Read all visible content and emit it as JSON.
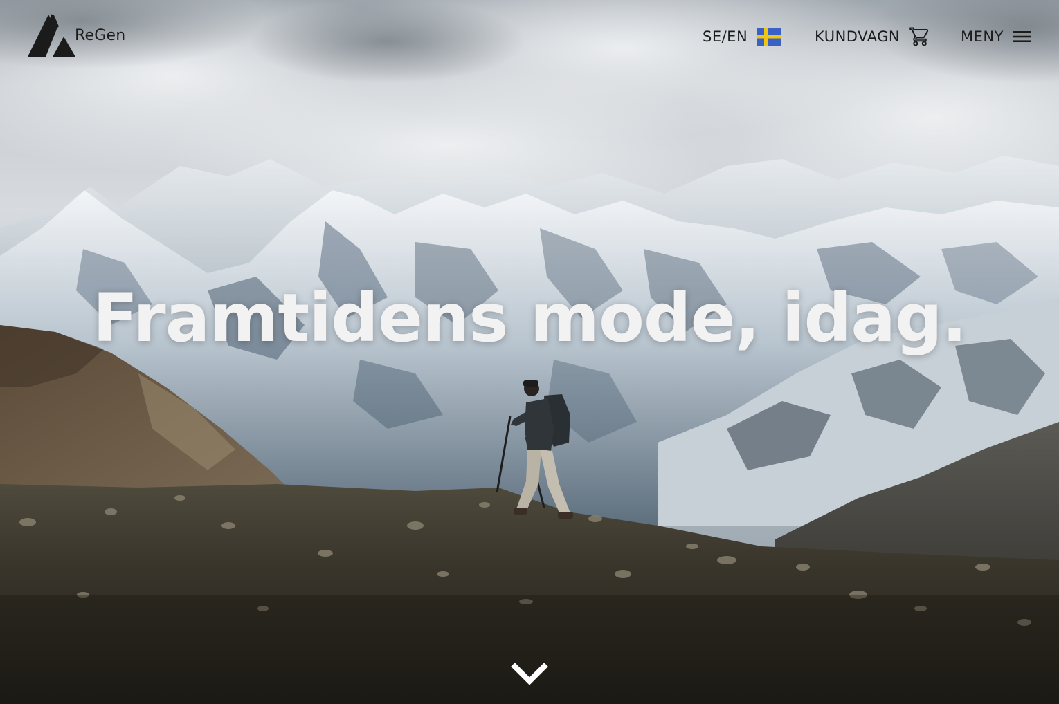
{
  "brand": {
    "name": "ReGen",
    "logo_icon": "mountain-triangle-logo"
  },
  "nav": {
    "language_label": "SE/EN",
    "language_flag": "sweden-flag-icon",
    "cart_label": "KUNDVAGN",
    "cart_icon": "shopping-cart-icon",
    "menu_label": "MENY",
    "menu_icon": "hamburger-menu-icon"
  },
  "hero": {
    "headline": "Framtidens mode, idag.",
    "scroll_icon": "chevron-down-icon"
  },
  "colors": {
    "text_dark": "#1c1c1c",
    "headline": "#f2f2f2",
    "flag_blue": "#3a62c4",
    "flag_yellow": "#f2c511"
  }
}
